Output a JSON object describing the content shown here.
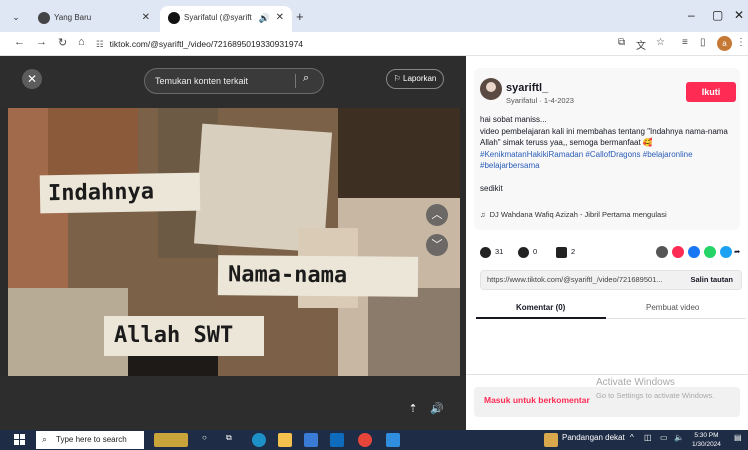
{
  "browser": {
    "tabs": [
      {
        "title": "Yang Baru",
        "active": false
      },
      {
        "title": "Syarifatul (@syariftl_) | TIK",
        "active": true
      }
    ],
    "new_tab": "+",
    "url": "tiktok.com/@syariftl_/video/7216895019330931974",
    "window_controls": [
      "–",
      "▢",
      "✕"
    ],
    "profile_initial": "a"
  },
  "video": {
    "search_placeholder": "Temukan konten terkait",
    "report_label": "Laporkan",
    "frame_texts": [
      "Indahnya",
      "Nama-nama",
      "Allah SWT"
    ]
  },
  "post": {
    "username": "syariftl_",
    "subtitle": "Syarifatul · 1-4-2023",
    "follow_label": "Ikuti",
    "description": "hai sobat maniss...\nvideo pembelajaran kali ini membahas tentang \"Indahnya nama-nama Allah\" simak teruss yaa,, semoga bermanfaat 🥰",
    "hashtags": "#KenikmatanHakikiRamadan #CallofDragons #belajaronline #belajarbersama",
    "see_more": "sedikit",
    "music": "DJ Wahdana Wafiq Azizah - Jibril Pertama mengulasi"
  },
  "stats": {
    "likes": "31",
    "comments": "0",
    "saves": "2"
  },
  "share_colors": [
    "#555555",
    "#fe2c55",
    "#1877f2",
    "#25d366",
    "#1da1f2"
  ],
  "link": {
    "url": "https://www.tiktok.com/@syariftl_/video/721689501...",
    "copy_label": "Salin tautan"
  },
  "panel_tabs": [
    {
      "label": "Komentar (0)",
      "active": true
    },
    {
      "label": "Pembuat video",
      "active": false
    }
  ],
  "login": {
    "label": "Masuk untuk berkomentar"
  },
  "watermark": {
    "title": "Activate Windows",
    "subtitle": "Go to Settings to activate Windows."
  },
  "taskbar": {
    "search_placeholder": "Type here to search",
    "weather_text": "Pandangan dekat",
    "time": "5:30 PM",
    "date": "1/30/2024"
  }
}
